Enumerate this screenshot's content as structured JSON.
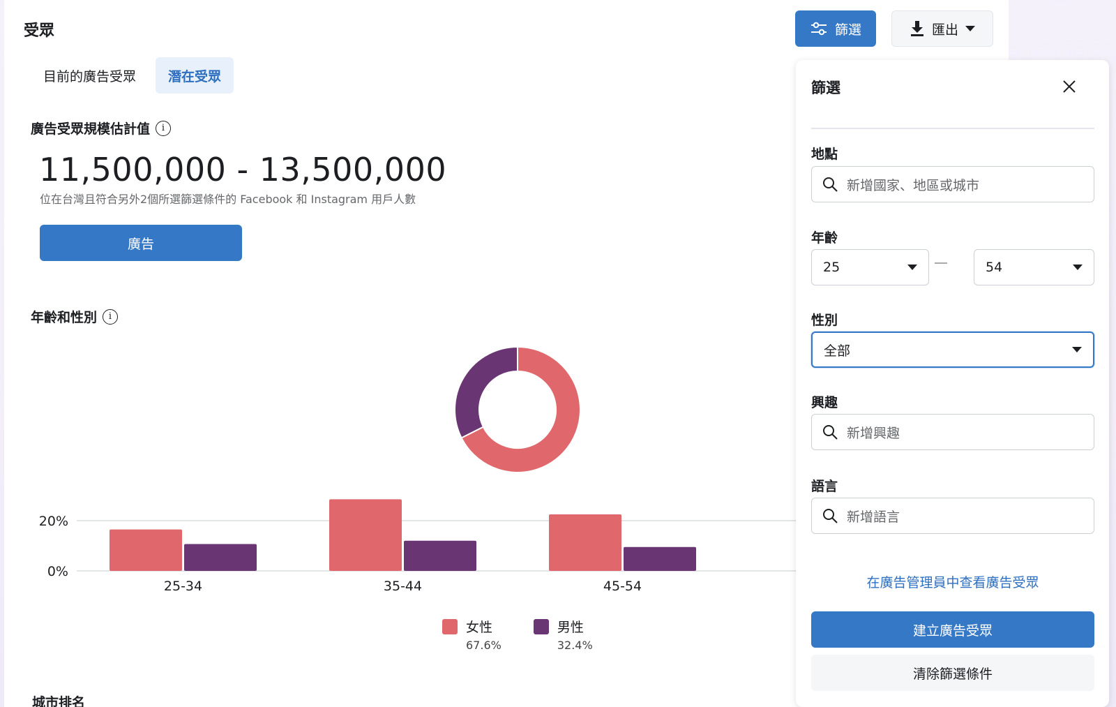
{
  "header": {
    "title": "受眾",
    "filter_button_label": "篩選",
    "export_button_label": "匯出"
  },
  "tabs": [
    {
      "label": "目前的廣告受眾",
      "active": false
    },
    {
      "label": "潛在受眾",
      "active": true
    }
  ],
  "audience_size": {
    "label": "廣告受眾規模估計值",
    "value": "11,500,000 - 13,500,000",
    "description": "位在台灣且符合另外2個所選篩選條件的 Facebook 和 Instagram 用戶人數",
    "ads_button_label": "廣告"
  },
  "age_gender": {
    "label": "年齡和性別"
  },
  "chart_data": {
    "type": "bar",
    "categories": [
      "25-34",
      "35-44",
      "45-54"
    ],
    "series": [
      {
        "name": "女性",
        "values": [
          16.5,
          28.5,
          22.5
        ],
        "color": "#e0686c",
        "share": "67.6%"
      },
      {
        "name": "男性",
        "values": [
          10.7,
          12.0,
          9.5
        ],
        "color": "#6a3573",
        "share": "32.4%"
      }
    ],
    "ytick_labels": [
      "0%",
      "20%"
    ],
    "yticks": [
      0,
      20
    ],
    "ylim": [
      0,
      28.5
    ],
    "grid": true,
    "donut": {
      "values": [
        67.6,
        32.4
      ],
      "colors": [
        "#e0686c",
        "#6a3573"
      ]
    }
  },
  "city_ranking": {
    "label": "城市排名"
  },
  "filter_panel": {
    "title": "篩選",
    "location": {
      "label": "地點",
      "placeholder": "新增國家、地區或城市"
    },
    "age": {
      "label": "年齡",
      "min": "25",
      "max": "54"
    },
    "gender": {
      "label": "性別",
      "value": "全部"
    },
    "interests": {
      "label": "興趣",
      "placeholder": "新增興趣"
    },
    "language": {
      "label": "語言",
      "placeholder": "新增語言"
    },
    "view_link": "在廣告管理員中查看廣告受眾",
    "create_button": "建立廣告受眾",
    "clear_button": "清除篩選條件"
  },
  "icons": {
    "filter": "sliders-icon",
    "export": "download-icon",
    "search": "search-icon",
    "close": "close-icon",
    "info": "info-icon"
  }
}
